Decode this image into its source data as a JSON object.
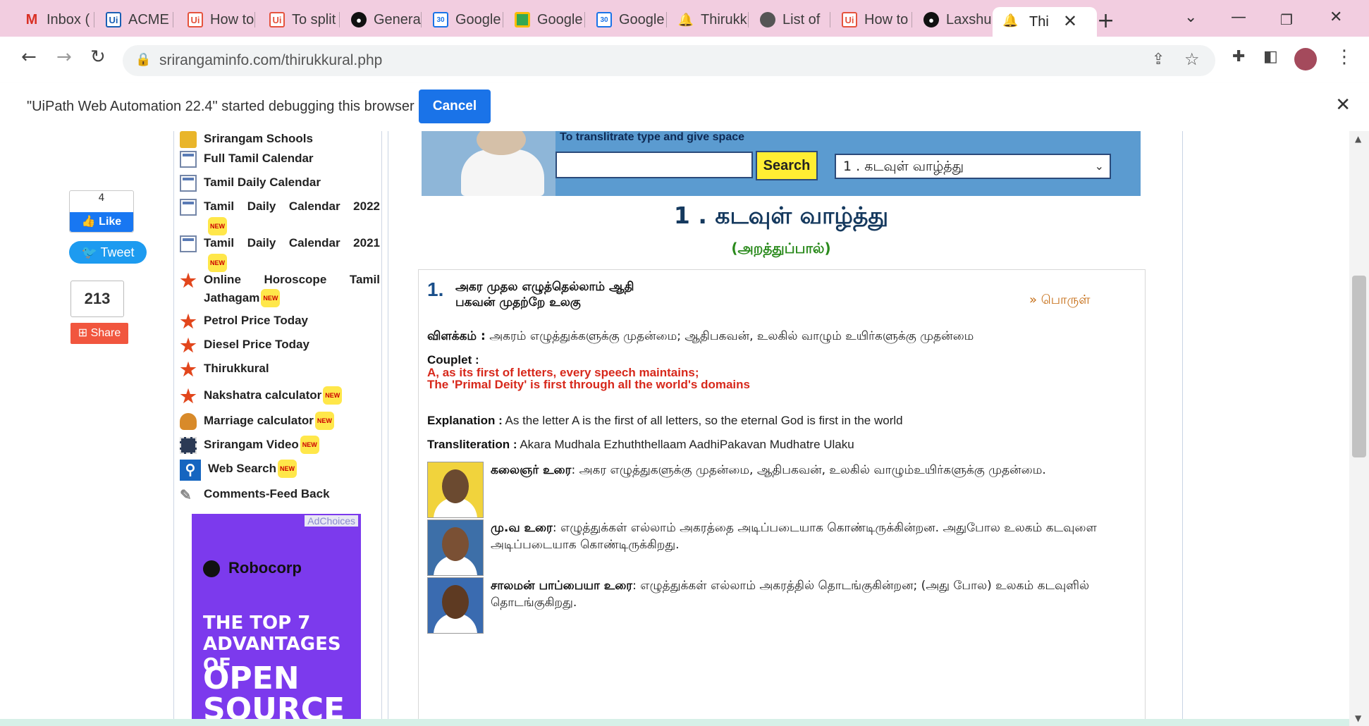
{
  "browser": {
    "tabs": [
      {
        "label": "Inbox (",
        "icon": "gmail-icon",
        "color": "#d93025"
      },
      {
        "label": "ACME",
        "icon": "uipath-icon",
        "color": "#1a5fb4"
      },
      {
        "label": "How to",
        "icon": "uipath-icon",
        "color": "#e5533d"
      },
      {
        "label": "To split",
        "icon": "uipath-icon",
        "color": "#e5533d"
      },
      {
        "label": "Genera",
        "icon": "github-icon",
        "color": "#111111"
      },
      {
        "label": "Google",
        "icon": "google-calendar-icon",
        "color": "#1a73e8"
      },
      {
        "label": "Google",
        "icon": "google-classroom-icon",
        "color": "#34a853"
      },
      {
        "label": "Google",
        "icon": "google-calendar-icon",
        "color": "#1a73e8"
      },
      {
        "label": "Thirukk",
        "icon": "bell-icon",
        "color": "#c8a020"
      },
      {
        "label": "List of",
        "icon": "globe-icon",
        "color": "#555555"
      },
      {
        "label": "How to",
        "icon": "uipath-icon",
        "color": "#e5533d"
      },
      {
        "label": "Laxshu",
        "icon": "github-icon",
        "color": "#111111"
      }
    ],
    "active_tab": {
      "label": "Thi",
      "icon": "bell-icon"
    },
    "new_tab": "+",
    "url": "srirangaminfo.com/thirukkural.php"
  },
  "debug_bar": {
    "message": "\"UiPath Web Automation 22.4\" started debugging this browser",
    "cancel_label": "Cancel"
  },
  "social": {
    "like_count": "4",
    "like_label": "Like",
    "tweet_label": "Tweet",
    "share_count": "213",
    "share_label": "Share"
  },
  "nav": {
    "items": [
      {
        "label": "Srirangam Schools",
        "icon": "school-icon",
        "new": ""
      },
      {
        "label": "Full Tamil Calendar",
        "icon": "calendar-icon",
        "new": ""
      },
      {
        "label": "Tamil Daily Calendar",
        "icon": "calendar-icon",
        "new": ""
      },
      {
        "label": "Tamil Daily Calendar 2022",
        "icon": "calendar-icon",
        "new": "NEW"
      },
      {
        "label": "Tamil Daily Calendar 2021",
        "icon": "calendar-icon",
        "new": "NEW"
      },
      {
        "label": "Online Horoscope Tamil Jathagam",
        "icon": "star-icon",
        "new": "NEW"
      },
      {
        "label": "Petrol Price Today",
        "icon": "star-icon",
        "new": ""
      },
      {
        "label": "Diesel Price Today",
        "icon": "star-icon",
        "new": ""
      },
      {
        "label": "Thirukkural",
        "icon": "star-icon",
        "new": ""
      },
      {
        "label": "Nakshatra calculator",
        "icon": "star-icon",
        "new": "NEW"
      },
      {
        "label": "Marriage calculator",
        "icon": "kalash-icon",
        "new": "NEW"
      },
      {
        "label": "Srirangam Video",
        "icon": "film-icon",
        "new": "NEW"
      },
      {
        "label": "Web Search",
        "icon": "magnifier-icon",
        "new": "NEW"
      },
      {
        "label": "Comments-Feed Back",
        "icon": "pencil-icon",
        "new": ""
      }
    ]
  },
  "ad": {
    "choices": "AdChoices",
    "brand": "Robocorp",
    "headline": "The top 7 advantages of",
    "big": "OPEN SOURCE"
  },
  "banner": {
    "hint": "To translitrate type and give space",
    "search_value": "",
    "search_label": "Search",
    "chapter_selected": "1 . கடவுள் வாழ்த்து"
  },
  "chapter": {
    "title": "1 . கடவுள் வாழ்த்து",
    "section": "(அறத்துப்பால்)"
  },
  "kural": {
    "number": "1.",
    "line1": "அகர முதல எழுத்தெல்லாம் ஆதி",
    "line2": "பகவன் முதற்றே உலகு",
    "porul_link": "» பொருள்",
    "vilakkam_label": "விளக்கம் :",
    "vilakkam": " அகரம் எழுத்துக்களுக்கு முதன்மை; ஆதிபகவன், உலகில் வாழும் உயிர்களுக்கு முதன்மை",
    "couplet_label": "Couplet :",
    "couplet_line1": "A, as its first of letters, every speech maintains;",
    "couplet_line2": "The 'Primal Deity' is first through all the world's domains",
    "explanation_label": "Explanation :",
    "explanation": " As the letter A is the first of all letters, so the eternal God is first in the world",
    "transliteration_label": "Transliteration :",
    "transliteration": " Akara Mudhala Ezhuththellaam AadhiPakavan Mudhatre Ulaku"
  },
  "commentaries": [
    {
      "author": "கலைஞர் உரை",
      "text": ": அகர எழுத்துகளுக்கு முதன்மை, ஆதிபகவன், உலகில் வாழும்உயிர்களுக்கு முதன்மை."
    },
    {
      "author": "மு.வ உரை",
      "text": ": எழுத்துக்கள் எல்லாம் அகரத்தை அடிப்படையாக கொண்டிருக்கின்றன. அதுபோல உலகம் கடவுளை அடிப்படையாக கொண்டிருக்கிறது."
    },
    {
      "author": "சாலமன் பாப்பையா உரை",
      "text": ": எழுத்துக்கள் எல்லாம் அகரத்தில் தொடங்குகின்றன; (அது போல) உலகம் கடவுளில் தொடங்குகிறது."
    }
  ]
}
